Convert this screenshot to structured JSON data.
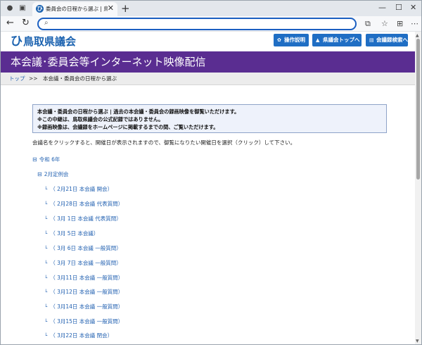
{
  "browser": {
    "tab_title": "委員会の日程から選ぶ | 鳥取県議会",
    "address_value": "",
    "new_tab_glyph": "+",
    "close_glyph": "✕"
  },
  "site": {
    "logo_glyph": "ひ",
    "logo_text": "鳥取県議会",
    "buttons": {
      "help": "操作説明",
      "assembly_top": "県議会トップへ",
      "minutes_search": "会議録検索へ"
    },
    "page_title": "本会議･委員会等インターネット映像配信"
  },
  "breadcrumb": {
    "home": "トップ",
    "separator": ">>",
    "current": "本会議・委員会の日程から選ぶ"
  },
  "notice": {
    "line1": "本会議・委員会の日程から選ぶ | 過去の本会議・委員会の録画映像を御覧いただけます。",
    "line2": "※この中継は、鳥取県議会の公式記録ではありません。",
    "line3": "※録画映像は、会議録をホームページに掲載するまでの間、ご覧いただけます。"
  },
  "instruction": "会議名をクリックすると、開催日が表示されますので、御覧になりたい開催日を選択（クリック）して下さい。",
  "tree": {
    "year_label": "令和 6年",
    "session_label": "2月定例会",
    "toggle_glyph": "⊟",
    "branch_glyph": "└",
    "sessions": [
      "（ 2月21日  本会議  開会）",
      "（ 2月28日  本会議  代表質問）",
      "（ 3月 1日  本会議  代表質問）",
      "（ 3月 5日  本会議）",
      "（ 3月 6日  本会議  一般質問）",
      "（ 3月 7日  本会議  一般質問）",
      "（ 3月11日  本会議  一般質問）",
      "（ 3月12日  本会議  一般質問）",
      "（ 3月14日  本会議  一般質問）",
      "（ 3月15日  本会議  一般質問）",
      "（ 3月22日  本会議  閉会）"
    ]
  },
  "colors": {
    "title_band": "#5a2d91",
    "header_button": "#1f6ec4",
    "link": "#1f5fb0",
    "notice_bg": "#eef2fb"
  }
}
